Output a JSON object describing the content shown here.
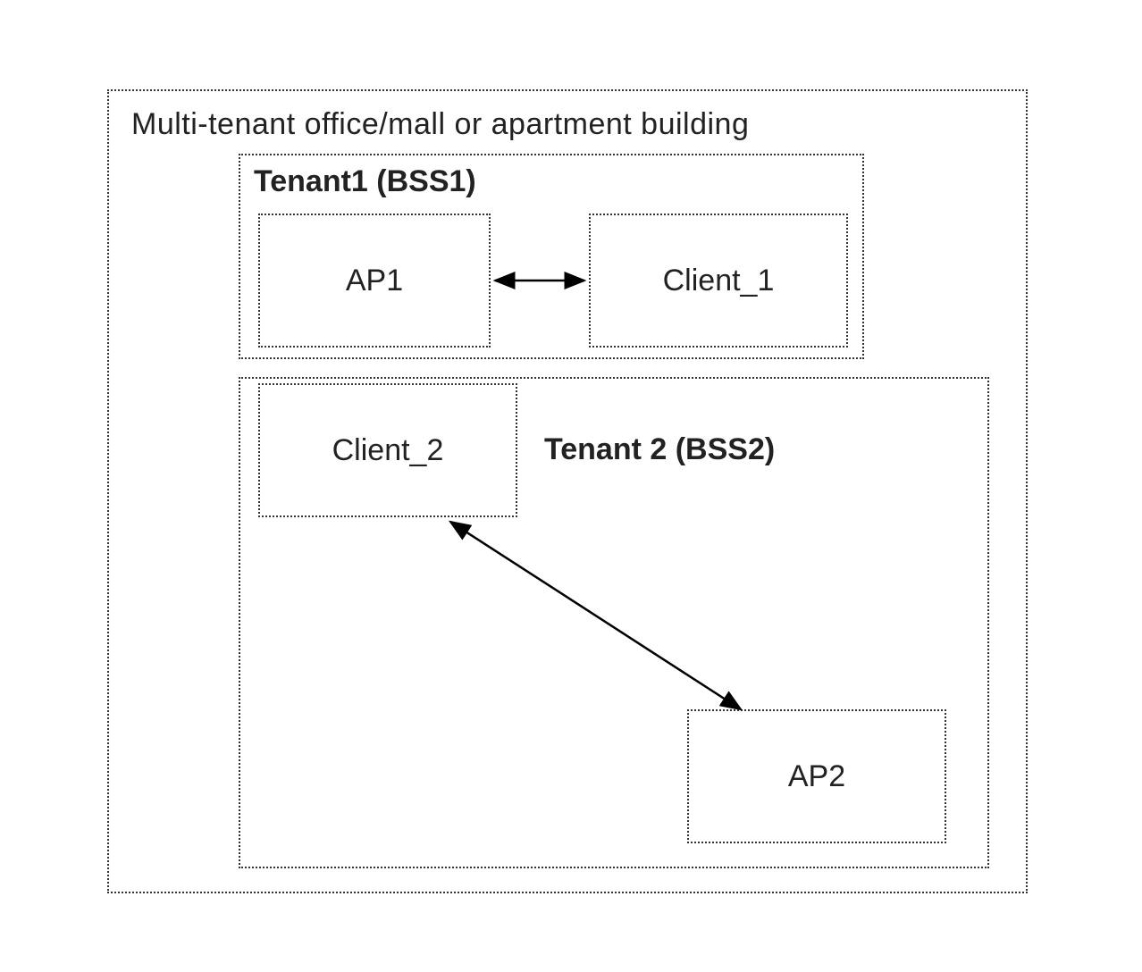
{
  "building": {
    "title": "Multi-tenant office/mall or apartment building"
  },
  "tenant1": {
    "title": "Tenant1 (BSS1)",
    "ap_label": "AP1",
    "client_label": "Client_1"
  },
  "tenant2": {
    "title": "Tenant 2 (BSS2)",
    "client_label": "Client_2",
    "ap_label": "AP2"
  }
}
